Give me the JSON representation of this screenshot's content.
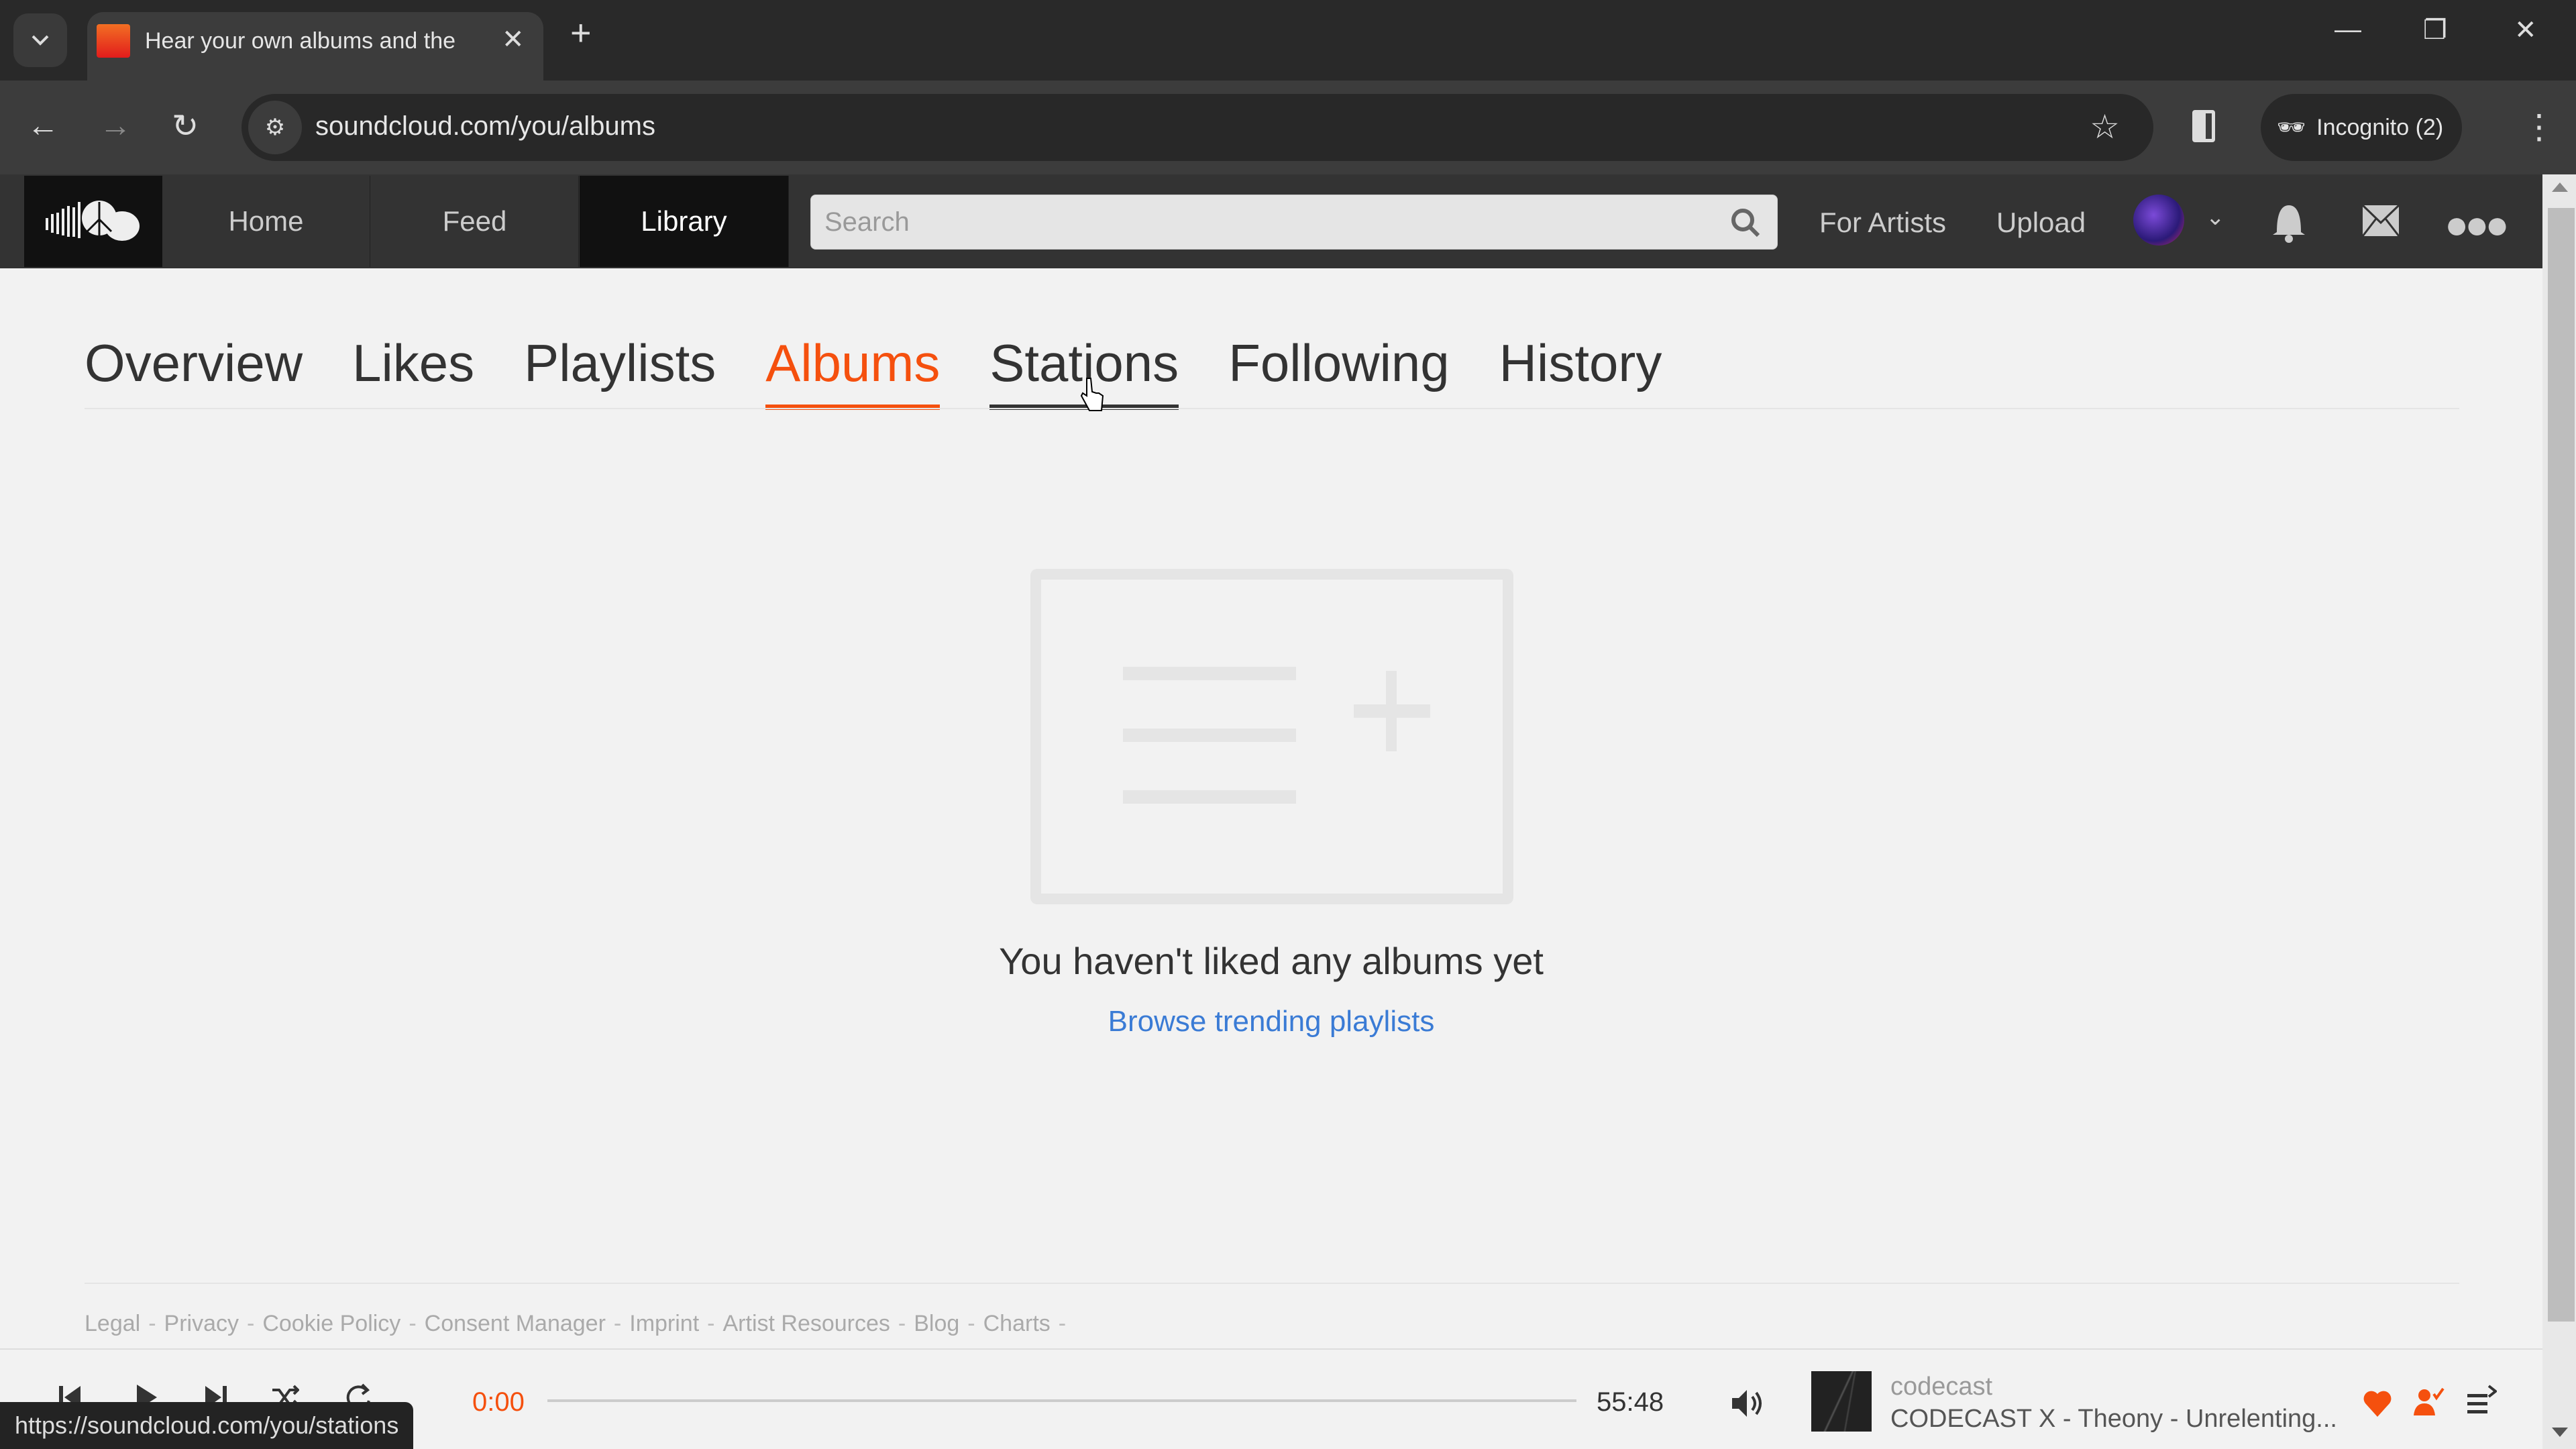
{
  "browser": {
    "tab_title": "Hear your own albums and the",
    "url": "soundcloud.com/you/albums",
    "profile_label": "Incognito (2)",
    "status_url": "https://soundcloud.com/you/stations"
  },
  "header": {
    "nav": [
      {
        "label": "Home",
        "active": false
      },
      {
        "label": "Feed",
        "active": false
      },
      {
        "label": "Library",
        "active": true
      }
    ],
    "search_placeholder": "Search",
    "search_value": "",
    "for_artists": "For Artists",
    "upload": "Upload",
    "icons": [
      "avatar",
      "chevron-down-icon",
      "bell-icon",
      "mail-icon",
      "more-icon"
    ]
  },
  "library": {
    "tabs": [
      {
        "label": "Overview",
        "state": "normal"
      },
      {
        "label": "Likes",
        "state": "normal"
      },
      {
        "label": "Playlists",
        "state": "normal"
      },
      {
        "label": "Albums",
        "state": "active"
      },
      {
        "label": "Stations",
        "state": "hover"
      },
      {
        "label": "Following",
        "state": "normal"
      },
      {
        "label": "History",
        "state": "normal"
      }
    ],
    "empty_message": "You haven't liked any albums yet",
    "browse_link": "Browse trending playlists"
  },
  "footer": {
    "links": [
      "Legal",
      "Privacy",
      "Cookie Policy",
      "Consent Manager",
      "Imprint",
      "Artist Resources",
      "Blog",
      "Charts"
    ],
    "separator": "-"
  },
  "player": {
    "current_time": "0:00",
    "total_time": "55:48",
    "progress_percent": 0,
    "artist": "codecast",
    "track": "CODECAST X - Theony - Unrelenting...",
    "liked": true,
    "following": true
  },
  "colors": {
    "accent": "#f5500e",
    "link": "#3a7bd5",
    "header_bg": "#333333"
  }
}
